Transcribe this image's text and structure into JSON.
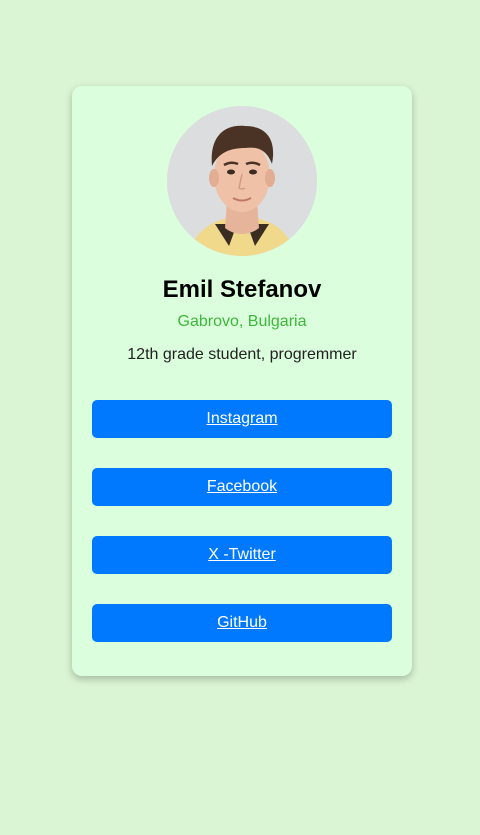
{
  "profile": {
    "name": "Emil Stefanov",
    "location": "Gabrovo, Bulgaria",
    "bio": "12th grade student, progremmer",
    "avatar_alt": "profile-photo"
  },
  "links": [
    {
      "label": "Instagram"
    },
    {
      "label": "Facebook"
    },
    {
      "label": "X -Twitter"
    },
    {
      "label": "GitHub"
    }
  ],
  "colors": {
    "page_background": "#daf5d4",
    "card_background": "#dbfedd",
    "button": "#0079ff",
    "location_text": "#3db83a"
  }
}
